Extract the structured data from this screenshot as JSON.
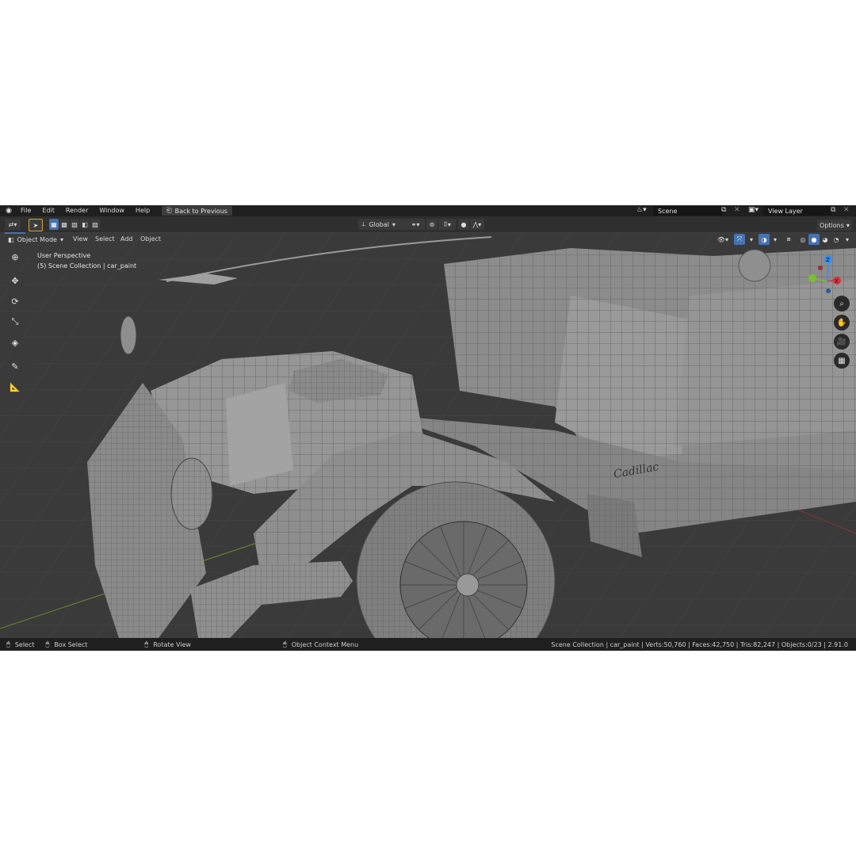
{
  "menu": {
    "items": [
      "File",
      "Edit",
      "Render",
      "Window",
      "Help"
    ],
    "back_label": "Back to Previous",
    "scene_value": "Scene",
    "view_layer_value": "View Layer"
  },
  "header": {
    "mode_label": "Object Mode",
    "view_label": "View",
    "select_label": "Select",
    "add_label": "Add",
    "object_label": "Object",
    "orientation_label": "Global",
    "options_label": "Options"
  },
  "viewport": {
    "perspective_label": "User Perspective",
    "collection_label": "(5) Scene Collection | car_paint",
    "gizmo": {
      "x": "X",
      "y": "Y",
      "z": "Z"
    },
    "emblem_text": "Cadillac"
  },
  "status": {
    "select_label": "Select",
    "box_select_label": "Box Select",
    "rotate_label": "Rotate View",
    "context_menu_label": "Object Context Menu",
    "stats": "Scene Collection | car_paint | Verts:50,760 | Faces:42,750 | Tris:82,247 | Objects:0/23 | 2.91.0"
  },
  "colors": {
    "accent": "#4772b3",
    "viewport_bg": "#3a3a3a",
    "axis_x": "#e0303e",
    "axis_y": "#7ac02d",
    "axis_z": "#2c8fff"
  }
}
